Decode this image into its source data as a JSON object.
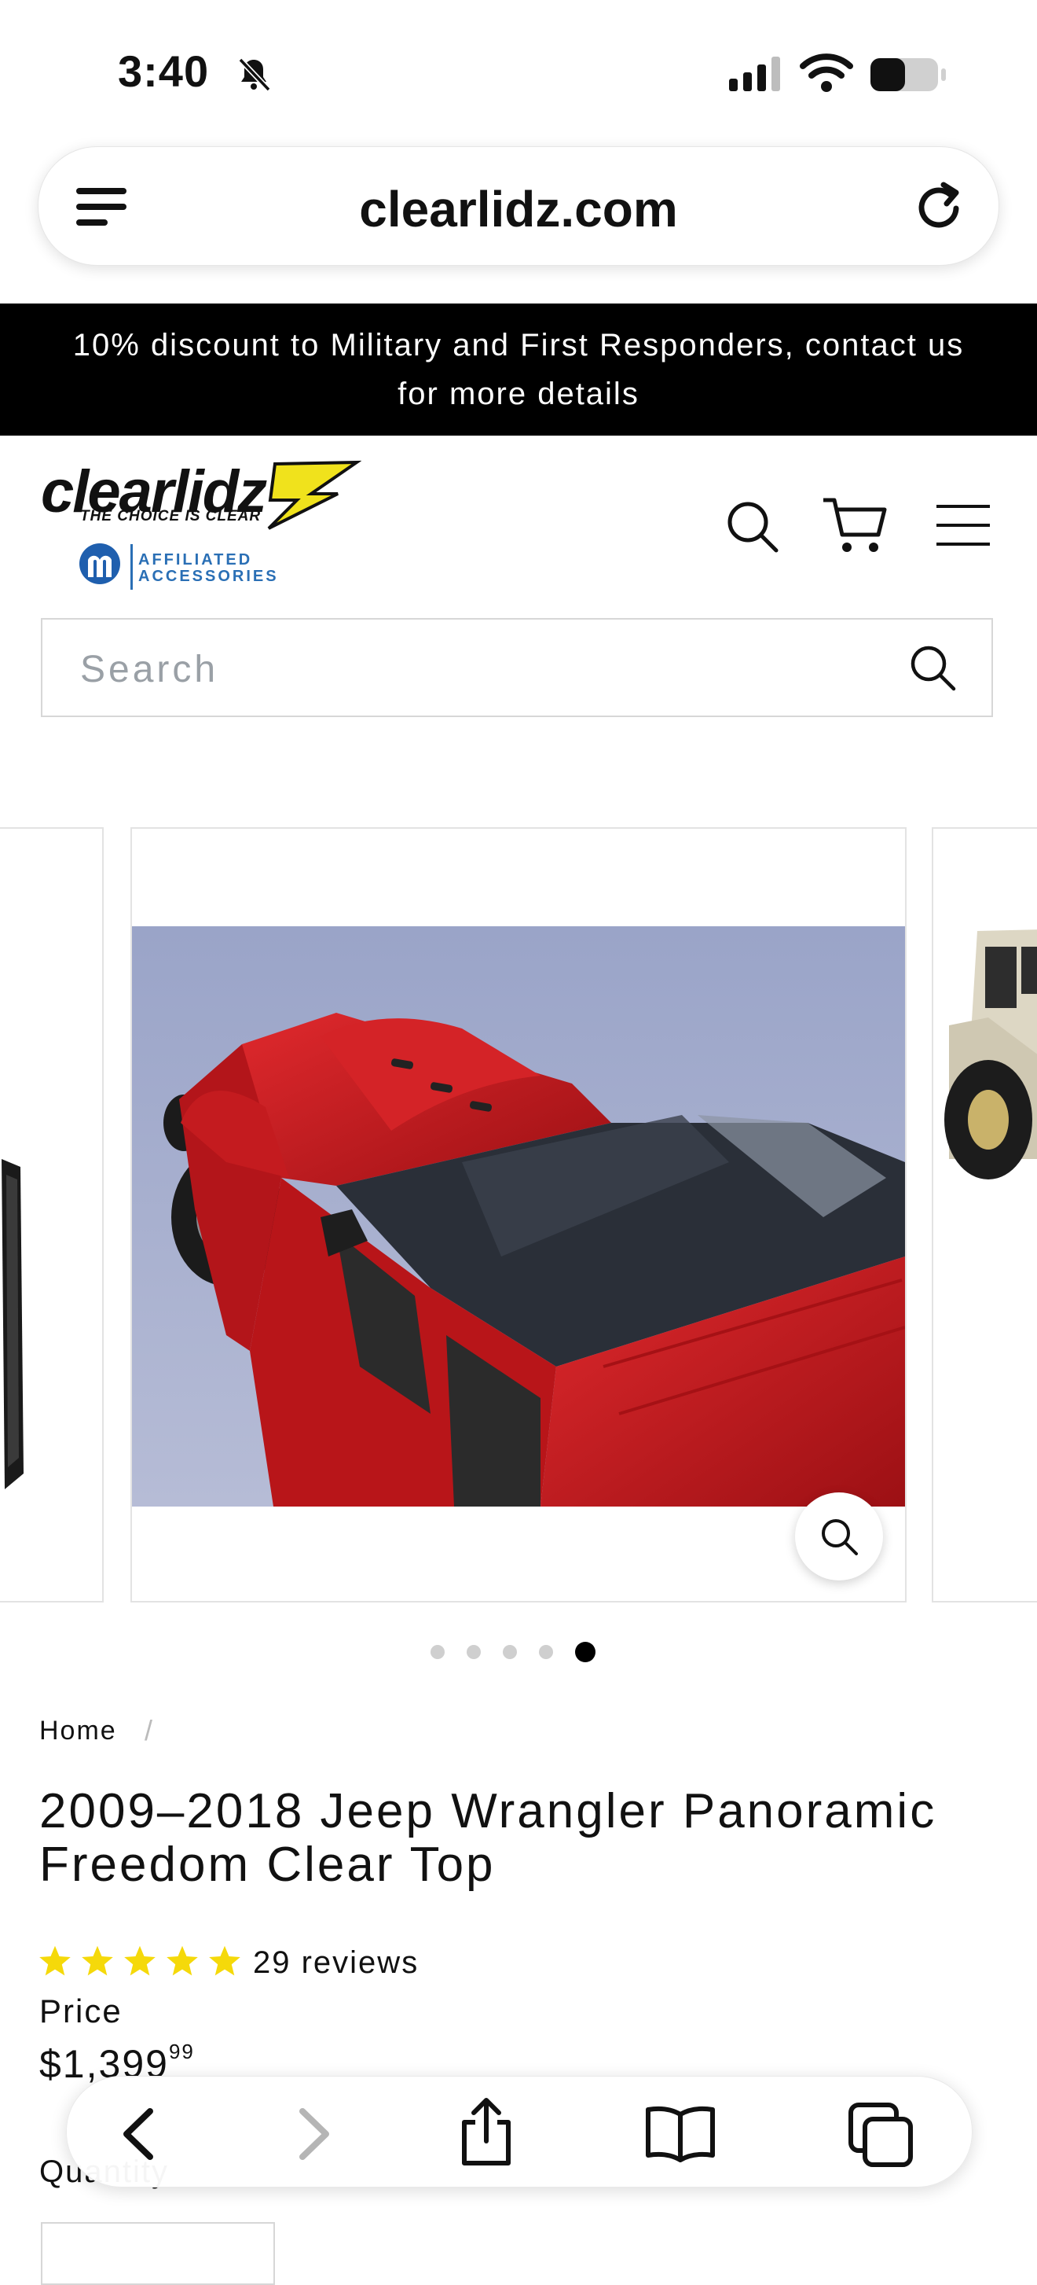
{
  "status_bar": {
    "time": "3:40"
  },
  "browser": {
    "url": "clearlidz.com",
    "menu_icon": "hamburger-icon",
    "reload_icon": "reload-icon"
  },
  "promo_banner": {
    "text": "10% discount to Military and First Responders, contact us for more details"
  },
  "header": {
    "logo_text": "clearlidz",
    "logo_tagline": "THE CHOICE IS CLEAR",
    "partner_line1": "AFFILIATED",
    "partner_line2": "ACCESSORIES",
    "partner_mark": "MOPAR"
  },
  "search": {
    "placeholder": "Search"
  },
  "carousel": {
    "slide_count": 5,
    "active_index": 4
  },
  "breadcrumb": {
    "home": "Home",
    "separator": "/"
  },
  "product": {
    "title": "2009–2018 Jeep Wrangler Panoramic Freedom Clear Top",
    "rating": 5,
    "reviews": "29 reviews",
    "price_label": "Price",
    "price_main": "$1,399",
    "price_cents": "99",
    "quantity_label": "Quantity"
  },
  "colors": {
    "accent_star": "#f5d90a",
    "banner_bg": "#000000",
    "vehicle_red": "#c4161c"
  }
}
